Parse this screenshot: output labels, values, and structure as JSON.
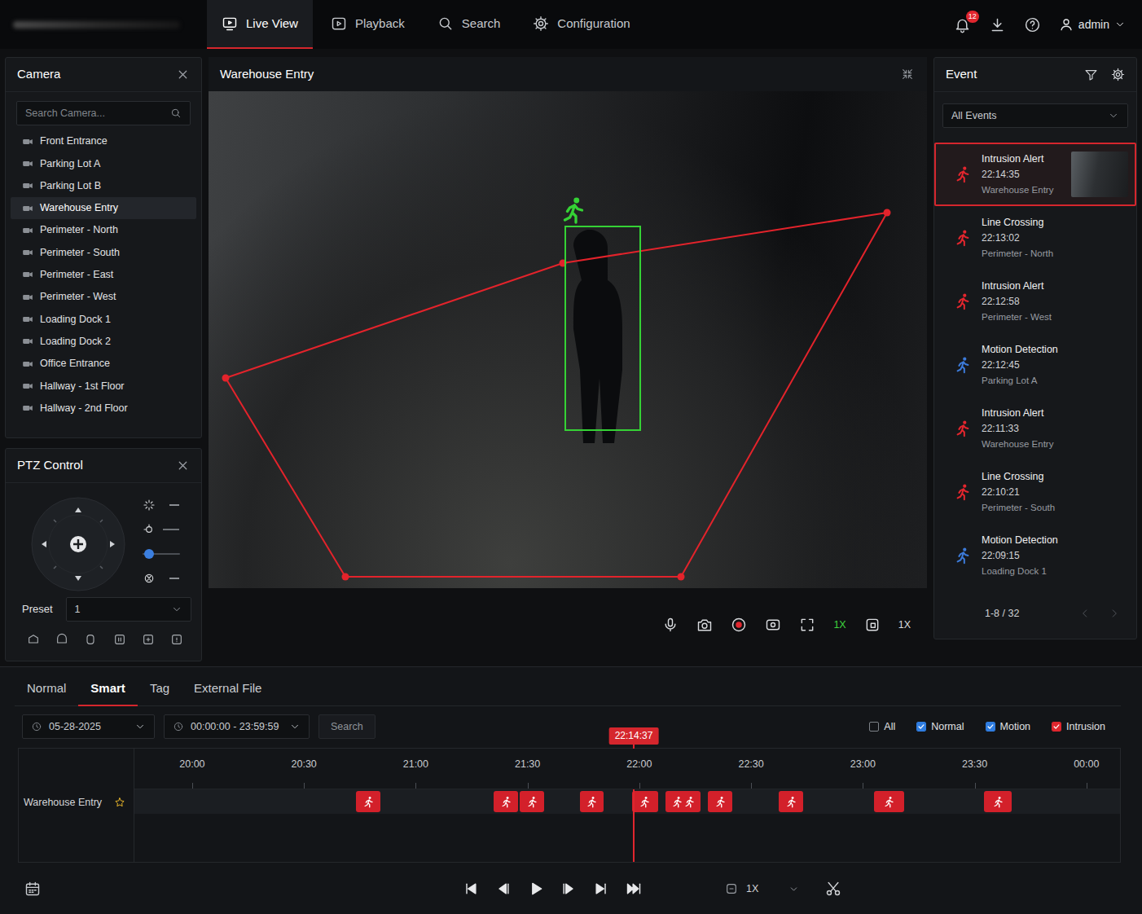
{
  "nav_tabs": [
    {
      "label": "Live View",
      "selected": true
    },
    {
      "label": "Playback",
      "selected": false
    },
    {
      "label": "Search",
      "selected": false
    },
    {
      "label": "Configuration",
      "selected": false
    }
  ],
  "notifications": {
    "count": "12"
  },
  "user": {
    "name": "admin"
  },
  "camera_panel": {
    "title": "Camera",
    "search_placeholder": "Search Camera...",
    "cameras": [
      {
        "name": "Front Entrance",
        "selected": false
      },
      {
        "name": "Parking Lot A",
        "selected": false
      },
      {
        "name": "Parking Lot B",
        "selected": false
      },
      {
        "name": "Warehouse Entry",
        "selected": true
      },
      {
        "name": "Perimeter - North",
        "selected": false
      },
      {
        "name": "Perimeter - South",
        "selected": false
      },
      {
        "name": "Perimeter - East",
        "selected": false
      },
      {
        "name": "Perimeter - West",
        "selected": false
      },
      {
        "name": "Loading Dock 1",
        "selected": false
      },
      {
        "name": "Loading Dock 2",
        "selected": false
      },
      {
        "name": "Office Entrance",
        "selected": false
      },
      {
        "name": "Hallway - 1st Floor",
        "selected": false
      },
      {
        "name": "Hallway - 2nd Floor",
        "selected": false
      }
    ]
  },
  "ptz": {
    "title": "PTZ Control",
    "speed": {
      "level": 0.05
    },
    "preset": {
      "label": "Preset",
      "value": "1"
    }
  },
  "video": {
    "title": "Warehouse Entry"
  },
  "video_toolbar": {
    "zoom": {
      "label": "1X",
      "on": true
    },
    "speed": "1X"
  },
  "events_panel": {
    "title": "Event",
    "filter": "All Events",
    "items": [
      {
        "type": "Intrusion Alert",
        "time": "22:14:35",
        "camera": "Warehouse Entry",
        "kind": "intrusion",
        "color": "#e3262e",
        "selected": true
      },
      {
        "type": "Line Crossing",
        "time": "22:13:02",
        "camera": "Perimeter - North",
        "kind": "line",
        "color": "#e3262e",
        "selected": false
      },
      {
        "type": "Intrusion Alert",
        "time": "22:12:58",
        "camera": "Perimeter - West",
        "kind": "intrusion",
        "color": "#e3262e",
        "selected": false
      },
      {
        "type": "Motion Detection",
        "time": "22:12:45",
        "camera": "Parking Lot A",
        "kind": "motion",
        "color": "#3c7ad8",
        "selected": false
      },
      {
        "type": "Intrusion Alert",
        "time": "22:11:33",
        "camera": "Warehouse Entry",
        "kind": "intrusion",
        "color": "#e3262e",
        "selected": false
      },
      {
        "type": "Line Crossing",
        "time": "22:10:21",
        "camera": "Perimeter - South",
        "kind": "line",
        "color": "#e3262e",
        "selected": false
      },
      {
        "type": "Motion Detection",
        "time": "22:09:15",
        "camera": "Loading Dock 1",
        "kind": "motion",
        "color": "#3c7ad8",
        "selected": false
      }
    ],
    "pagination": "1-8 / 32"
  },
  "playback_panel": {
    "tabs": [
      {
        "label": "Normal",
        "selected": false
      },
      {
        "label": "Smart",
        "selected": true
      },
      {
        "label": "Tag",
        "selected": false
      },
      {
        "label": "External File",
        "selected": false
      }
    ],
    "date": "05-28-2025",
    "time_range": "00:00:00 - 23:59:59",
    "search_button": "Search",
    "filters": [
      {
        "label": "All",
        "checked": false,
        "color": "#7d8288"
      },
      {
        "label": "Normal",
        "checked": true,
        "color": "#2f7de1"
      },
      {
        "label": "Motion",
        "checked": true,
        "color": "#2f7de1"
      },
      {
        "label": "Intrusion",
        "checked": true,
        "color": "#e0262e"
      }
    ],
    "timeline": {
      "axis": {
        "start": 1184.5,
        "end": 1449
      },
      "ticks": [
        {
          "label": "20:00",
          "value": 1200
        },
        {
          "label": "20:30",
          "value": 1230
        },
        {
          "label": "21:00",
          "value": 1260
        },
        {
          "label": "21:30",
          "value": 1290
        },
        {
          "label": "22:00",
          "value": 1320
        },
        {
          "label": "22:30",
          "value": 1350
        },
        {
          "label": "23:00",
          "value": 1380
        },
        {
          "label": "23:30",
          "value": 1410
        },
        {
          "label": "00:00",
          "value": 1440
        }
      ],
      "cursor": {
        "label": "22:14:37",
        "value": 1318.5
      },
      "rows": [
        {
          "name": "Warehouse Entry",
          "starred": true,
          "events": [
            {
              "start": 1244,
              "end": 1250.5,
              "kind": "intrusion"
            },
            {
              "start": 1281,
              "end": 1287.5,
              "kind": "intrusion"
            },
            {
              "start": 1288,
              "end": 1294.5,
              "kind": "intrusion"
            },
            {
              "start": 1304,
              "end": 1310.5,
              "kind": "intrusion"
            },
            {
              "start": 1318,
              "end": 1325,
              "kind": "intrusion"
            },
            {
              "start": 1327,
              "end": 1336.5,
              "kind": "line"
            },
            {
              "start": 1338.5,
              "end": 1345,
              "kind": "intrusion"
            },
            {
              "start": 1357.5,
              "end": 1364,
              "kind": "intrusion"
            },
            {
              "start": 1383,
              "end": 1391,
              "kind": "intrusion"
            },
            {
              "start": 1412.5,
              "end": 1420,
              "kind": "intrusion"
            }
          ]
        }
      ]
    }
  },
  "playback_controls": {
    "speed": "1X"
  }
}
